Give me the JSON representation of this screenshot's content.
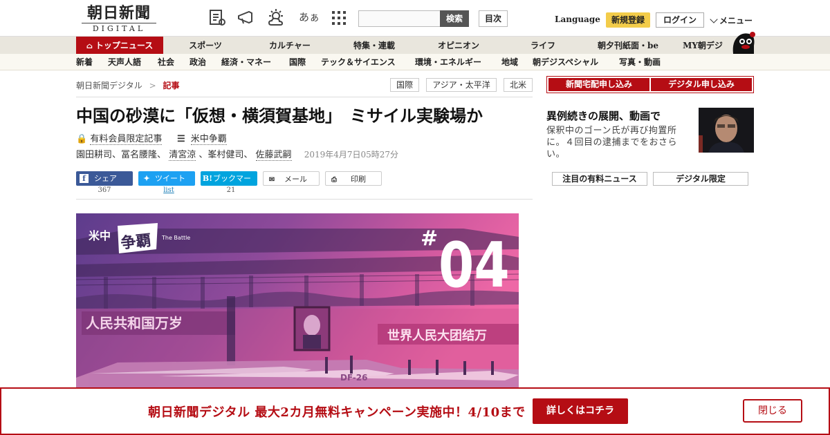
{
  "header": {
    "logo_jp": "朝日新聞",
    "logo_en": "DIGITAL",
    "font_size_icon_label": "あぁ",
    "search_button": "検索",
    "toc_button": "目次",
    "language": "Language",
    "signup": "新規登録",
    "login": "ログイン",
    "menu": "メニュー"
  },
  "main_nav": [
    {
      "label": "トップニュース"
    },
    {
      "label": "スポーツ"
    },
    {
      "label": "カルチャー"
    },
    {
      "label": "特集・連載"
    },
    {
      "label": "オピニオン"
    },
    {
      "label": "ライフ"
    },
    {
      "label": "朝夕刊紙面・be"
    },
    {
      "label": "MY朝デジ"
    }
  ],
  "sub_nav": [
    "新着",
    "天声人語",
    "社会",
    "政治",
    "経済・マネー",
    "国際",
    "テック＆サイエンス",
    "環境・エネルギー",
    "地域",
    "朝デジスペシャル",
    "写真・動画"
  ],
  "breadcrumb": {
    "home": "朝日新聞デジタル",
    "sep": ">",
    "current": "記事"
  },
  "tags": [
    "国際",
    "アジア・太平洋",
    "北米"
  ],
  "article": {
    "title": "中国の砂漠に「仮想・横須賀基地」　ミサイル実験場か",
    "paid_label": "有料会員限定記事",
    "series_label": "米中争覇",
    "authors": [
      {
        "name": "園田耕司",
        "linked": false
      },
      {
        "name": "冨名腰隆",
        "linked": false
      },
      {
        "name": "清宮涼",
        "linked": true
      },
      {
        "name": "峯村健司",
        "linked": false
      },
      {
        "name": "佐藤武嗣",
        "linked": true
      }
    ],
    "author_sep": "、",
    "date": "2019年4月7日05時27分"
  },
  "share": {
    "facebook": {
      "label": "シェア",
      "count": "367"
    },
    "twitter": {
      "label": "ツイート",
      "count": "list"
    },
    "hatena": {
      "label": "ブックマーク",
      "count": "21"
    },
    "mail": {
      "label": "メール"
    },
    "print": {
      "label": "印刷"
    }
  },
  "hero": {
    "series_jp1": "米中",
    "series_jp2": "争覇",
    "series_en": "The Battle",
    "hash": "#",
    "number": "04",
    "banner_left": "人民共和国万岁",
    "banner_right": "世界人民大团结万",
    "missile_code": "DF-26"
  },
  "sidebar": {
    "btn_delivery": "新聞宅配申し込み",
    "btn_digital": "デジタル申し込み",
    "news_title": "異例続きの展開、動画で",
    "news_desc": "保釈中のゴーン氏が再び拘置所に。４回目の逮捕までをおさらい。",
    "tab_paid": "注目の有料ニュース",
    "tab_digital": "デジタル限定"
  },
  "banner": {
    "text": "朝日新聞デジタル 最大2カ月無料キャンペーン実施中！4/10まで",
    "cta": "詳しくはコチラ",
    "close": "閉じる"
  },
  "colors": {
    "brand_red": "#b50d14",
    "signup_yellow": "#f3cc4a",
    "facebook": "#3b5998",
    "twitter": "#1da1f2",
    "hatena": "#00a4de"
  }
}
